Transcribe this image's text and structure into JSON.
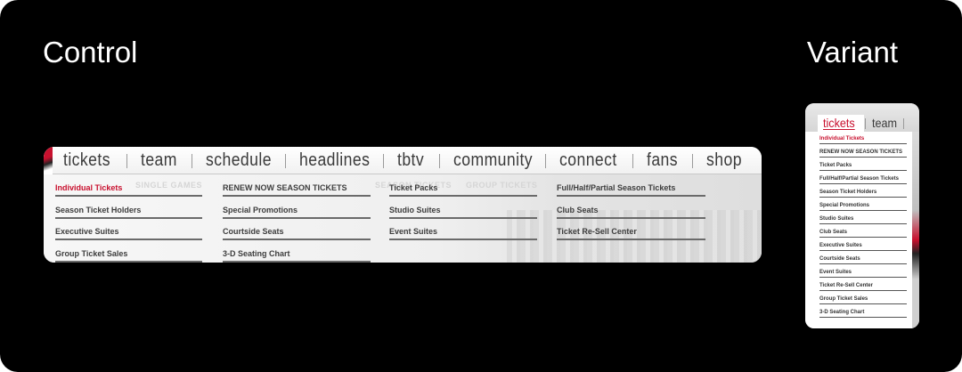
{
  "labels": {
    "control": "Control",
    "variant": "Variant"
  },
  "control": {
    "nav": [
      "tickets",
      "team",
      "schedule",
      "headlines",
      "tbtv",
      "community",
      "connect",
      "fans",
      "shop"
    ],
    "ghost_tabs": [
      "SINGLE GAMES",
      "SEASON TICKETS",
      "GROUP TICKETS"
    ],
    "columns": [
      [
        "Individual Tickets",
        "Season Ticket Holders",
        "Executive Suites",
        "Group Ticket Sales"
      ],
      [
        "RENEW NOW SEASON TICKETS",
        "Special Promotions",
        "Courtside Seats",
        "3-D Seating Chart"
      ],
      [
        "Ticket Packs",
        "Studio Suites",
        "Event Suites"
      ],
      [
        "Full/Half/Partial Season Tickets",
        "Club Seats",
        "Ticket Re-Sell Center"
      ]
    ]
  },
  "variant": {
    "tabs": [
      "tickets",
      "team"
    ],
    "items": [
      "Individual Tickets",
      "RENEW NOW SEASON TICKETS",
      "Ticket Packs",
      "Full/Half/Partial Season Tickets",
      "Season Ticket Holders",
      "Special Promotions",
      "Studio Suites",
      "Club Seats",
      "Executive Suites",
      "Courtside Seats",
      "Event Suites",
      "Ticket Re-Sell Center",
      "Group Ticket Sales",
      "3-D Seating Chart"
    ]
  },
  "colors": {
    "accent": "#c8102e",
    "background": "#000000",
    "text": "#3a3a3a"
  }
}
